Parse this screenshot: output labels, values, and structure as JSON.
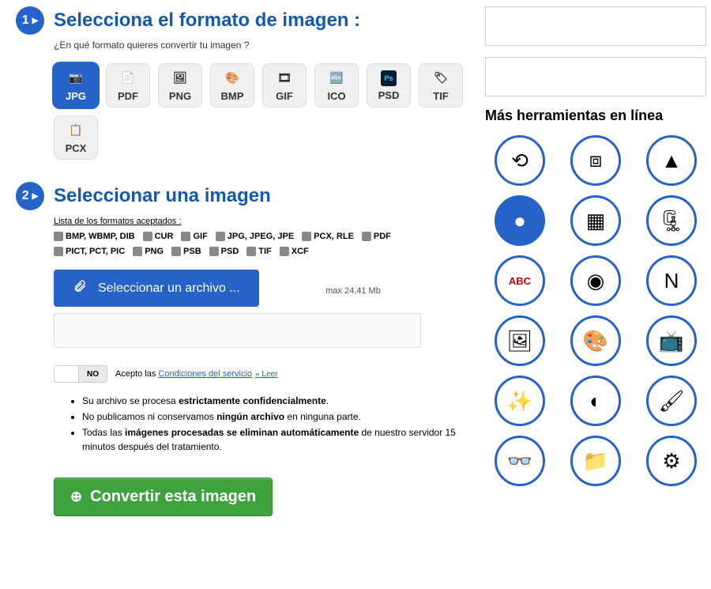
{
  "step1": {
    "badge": "1",
    "title": "Selecciona el formato de imagen :",
    "subtitle": "¿En qué formato quieres convertir tu imagen ?",
    "formats": [
      "JPG",
      "PDF",
      "PNG",
      "BMP",
      "GIF",
      "ICO",
      "PSD",
      "TIF",
      "PCX"
    ],
    "selected": "JPG"
  },
  "step2": {
    "badge": "2",
    "title": "Seleccionar una imagen",
    "accepted_label": "Lista de los formatos aceptados :",
    "accepted": [
      "BMP, WBMP, DIB",
      "CUR",
      "GIF",
      "JPG, JPEG, JPE",
      "PCX, RLE",
      "PDF",
      "PICT, PCT, PIC",
      "PNG",
      "PSB",
      "PSD",
      "TIF",
      "XCF"
    ],
    "file_button": "Seleccionar un archivo ...",
    "max_size": "max 24,41 Mb",
    "toggle_no": "NO",
    "terms_prefix": "Acepto las ",
    "terms_link": "Condiciones del servicio",
    "read_link": "» Leer",
    "privacy": {
      "line1_a": "Su archivo se procesa ",
      "line1_b": "estrictamente confidencialmente",
      "line1_c": ".",
      "line2_a": "No publicamos ni conservamos ",
      "line2_b": "ningún archivo",
      "line2_c": " en ninguna parte.",
      "line3_a": "Todas las ",
      "line3_b": "imágenes procesadas se eliminan automáticamente",
      "line3_c": " de nuestro servidor 15 minutos después del tratamiento."
    }
  },
  "convert_label": "Convertir esta imagen",
  "sidebar": {
    "tools_title": "Más herramientas en línea",
    "tools": [
      {
        "name": "rotate-tool",
        "glyph": "⟲"
      },
      {
        "name": "crop-tool",
        "glyph": "⧈"
      },
      {
        "name": "mirror-tool",
        "glyph": "▲"
      },
      {
        "name": "resize-tool",
        "glyph": "●"
      },
      {
        "name": "grid-tool",
        "glyph": "▦"
      },
      {
        "name": "compress-tool",
        "glyph": "🗜"
      },
      {
        "name": "abc-tool",
        "glyph": "ABC"
      },
      {
        "name": "badge-tool",
        "glyph": "◉"
      },
      {
        "name": "nb-tool",
        "glyph": "N"
      },
      {
        "name": "sepia-tool",
        "glyph": "🖼"
      },
      {
        "name": "palette-tool",
        "glyph": "🎨"
      },
      {
        "name": "tv-tool",
        "glyph": "📺"
      },
      {
        "name": "effects-tool",
        "glyph": "✨"
      },
      {
        "name": "sphere-tool",
        "glyph": "◐"
      },
      {
        "name": "brush-tool",
        "glyph": "🖌"
      },
      {
        "name": "3d-tool",
        "glyph": "👓"
      },
      {
        "name": "folder-tool",
        "glyph": "📁"
      },
      {
        "name": "icons-tool",
        "glyph": "⚙"
      }
    ]
  }
}
